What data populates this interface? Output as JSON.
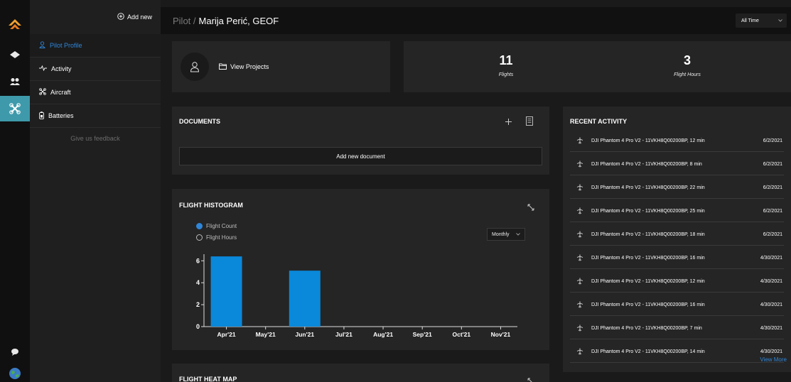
{
  "sidebar": {
    "add_new_label": "Add new",
    "items": [
      {
        "label": "Pilot Profile",
        "icon": "person-icon"
      },
      {
        "label": "Activity",
        "icon": "pulse-icon"
      },
      {
        "label": "Aircraft",
        "icon": "drone-icon"
      },
      {
        "label": "Batteries",
        "icon": "battery-icon"
      }
    ],
    "feedback_label": "Give us feedback"
  },
  "header": {
    "breadcrumb_prefix": "Pilot /",
    "pilot_name": "Marija Perić, GEOF",
    "time_filter": "All Time"
  },
  "profile": {
    "view_projects_label": "View Projects"
  },
  "stats": {
    "flights_value": "11",
    "flights_label": "Flights",
    "hours_value": "3",
    "hours_label": "Flight Hours"
  },
  "documents": {
    "title": "DOCUMENTS",
    "add_label": "Add new document"
  },
  "histogram": {
    "title": "FLIGHT HISTOGRAM",
    "option_count": "Flight Count",
    "option_hours": "Flight Hours",
    "period": "Monthly"
  },
  "heatmap": {
    "title": "FLIGHT HEAT MAP"
  },
  "chart_data": {
    "type": "bar",
    "categories": [
      "Apr'21",
      "May'21",
      "Jun'21",
      "Jul'21",
      "Aug'21",
      "Sep'21",
      "Oct'21",
      "Nov'21"
    ],
    "values": [
      6.4,
      0,
      5.1,
      0,
      0,
      0,
      0,
      0
    ],
    "yticks": [
      0,
      2,
      4,
      6
    ],
    "ylim": [
      0,
      6.6
    ],
    "grid": false,
    "bar_color": "#0a88da"
  },
  "recent_activity": {
    "title": "RECENT ACTIVITY",
    "rows": [
      {
        "text": "DJI Phantom 4 Pro V2 - 11VKH8Q00200BP, 12 min",
        "date": "6/2/2021"
      },
      {
        "text": "DJI Phantom 4 Pro V2 - 11VKH8Q00200BP, 8 min",
        "date": "6/2/2021"
      },
      {
        "text": "DJI Phantom 4 Pro V2 - 11VKH8Q00200BP, 22 min",
        "date": "6/2/2021"
      },
      {
        "text": "DJI Phantom 4 Pro V2 - 11VKH8Q00200BP, 25 min",
        "date": "6/2/2021"
      },
      {
        "text": "DJI Phantom 4 Pro V2 - 11VKH8Q00200BP, 18 min",
        "date": "6/2/2021"
      },
      {
        "text": "DJI Phantom 4 Pro V2 - 11VKH8Q00200BP, 16 min",
        "date": "4/30/2021"
      },
      {
        "text": "DJI Phantom 4 Pro V2 - 11VKH8Q00200BP, 12 min",
        "date": "4/30/2021"
      },
      {
        "text": "DJI Phantom 4 Pro V2 - 11VKH8Q00200BP, 16 min",
        "date": "4/30/2021"
      },
      {
        "text": "DJI Phantom 4 Pro V2 - 11VKH8Q00200BP, 7 min",
        "date": "4/30/2021"
      },
      {
        "text": "DJI Phantom 4 Pro V2 - 11VKH8Q00200BP, 14 min",
        "date": "4/30/2021"
      }
    ],
    "view_more_label": "View More"
  },
  "colors": {
    "accent": "#2f86d8",
    "active_rail": "#3e9aab",
    "bar": "#0a88da",
    "card_bg": "#252525"
  }
}
